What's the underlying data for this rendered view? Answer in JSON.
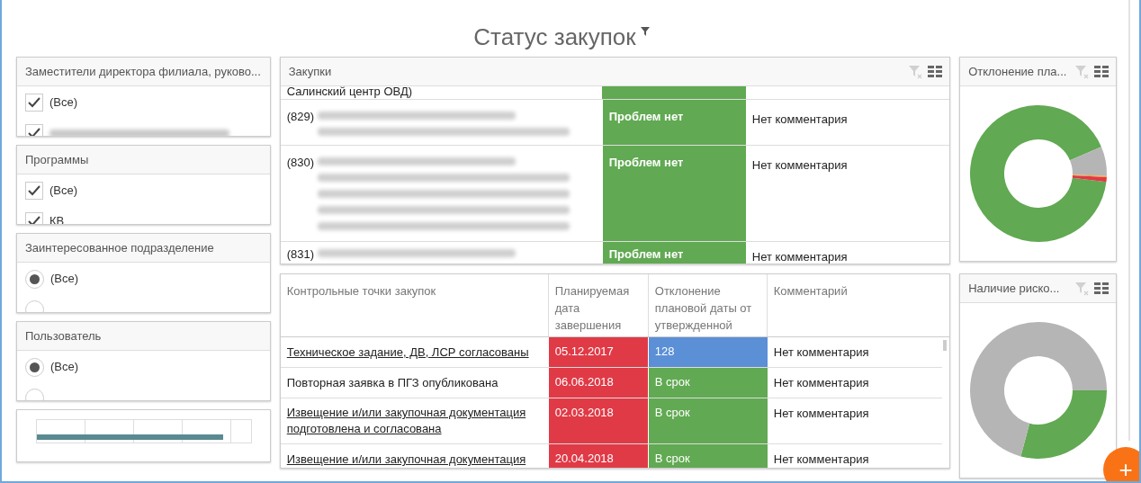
{
  "title": "Статус закупок",
  "filters": [
    {
      "title": "Заместители директора филиала, руково...",
      "kind": "checkbox",
      "options": [
        {
          "label": "(Все)",
          "checked": true,
          "blurred": false
        },
        {
          "checked": true,
          "blurred": true
        }
      ]
    },
    {
      "title": "Программы",
      "kind": "checkbox",
      "options": [
        {
          "label": "(Все)",
          "checked": true,
          "blurred": false
        },
        {
          "label": "КВ",
          "checked": true,
          "blurred": false
        }
      ]
    },
    {
      "title": "Заинтересованное подразделение",
      "kind": "radio",
      "options": [
        {
          "label": "(Все)",
          "selected": true
        },
        {
          "selected": false
        }
      ]
    },
    {
      "title": "Пользователь",
      "kind": "radio",
      "options": [
        {
          "label": "(Все)",
          "selected": true
        },
        {
          "selected": false
        }
      ]
    }
  ],
  "gauge": {
    "level": 0.87
  },
  "procurements": {
    "title": "Закупки",
    "rows": [
      {
        "kind": "tail",
        "text": "Салинский центр ОВД)",
        "color": "#61a952"
      },
      {
        "kind": "short",
        "number": "(829)",
        "status": "Проблем нет",
        "color": "#61a952",
        "comment": "Нет комментария"
      },
      {
        "kind": "long",
        "number": "(830)",
        "status": "Проблем нет",
        "color": "#61a952",
        "comment": "Нет комментария"
      },
      {
        "kind": "cut",
        "number": "(831)",
        "status": "Проблем нет",
        "color": "#61a952",
        "comment": "Нет комментария"
      }
    ]
  },
  "checkpoints": {
    "columns": [
      "Контрольные точки закупок",
      "Планируемая дата завершения",
      "Отклонение плановой даты от утвержденной",
      "Комментарий"
    ],
    "rows": [
      {
        "name": "Техническое задание, ДВ, ЛСР согласованы",
        "link": true,
        "date": {
          "text": "05.12.2017",
          "color": "#e03a47"
        },
        "deviation": {
          "text": "128",
          "color": "#5b8fd6"
        },
        "comment": "Нет комментария"
      },
      {
        "name": "Повторная заявка в ПГЗ опубликована",
        "link": false,
        "date": {
          "text": "06.06.2018",
          "color": "#e03a47"
        },
        "deviation": {
          "text": "В срок",
          "color": "#61a952"
        },
        "comment": "Нет комментария"
      },
      {
        "name": "Извещение и/или закупочная документация подготовлена и согласована",
        "link": true,
        "date": {
          "text": "02.03.2018",
          "color": "#e03a47"
        },
        "deviation": {
          "text": "В срок",
          "color": "#61a952"
        },
        "comment": "Нет комментария"
      },
      {
        "name": "Извещение и/или закупочная документация",
        "link": true,
        "date": {
          "text": "20.04.2018",
          "color": "#e03a47"
        },
        "deviation": {
          "text": "В срок",
          "color": "#61a952"
        },
        "comment": "Нет комментария"
      }
    ]
  },
  "charts": [
    {
      "title": "Отклонение пла...",
      "kind": "deviation"
    },
    {
      "title": "Наличие риско...",
      "kind": "risks"
    }
  ],
  "add_button": {
    "label": "+"
  }
}
